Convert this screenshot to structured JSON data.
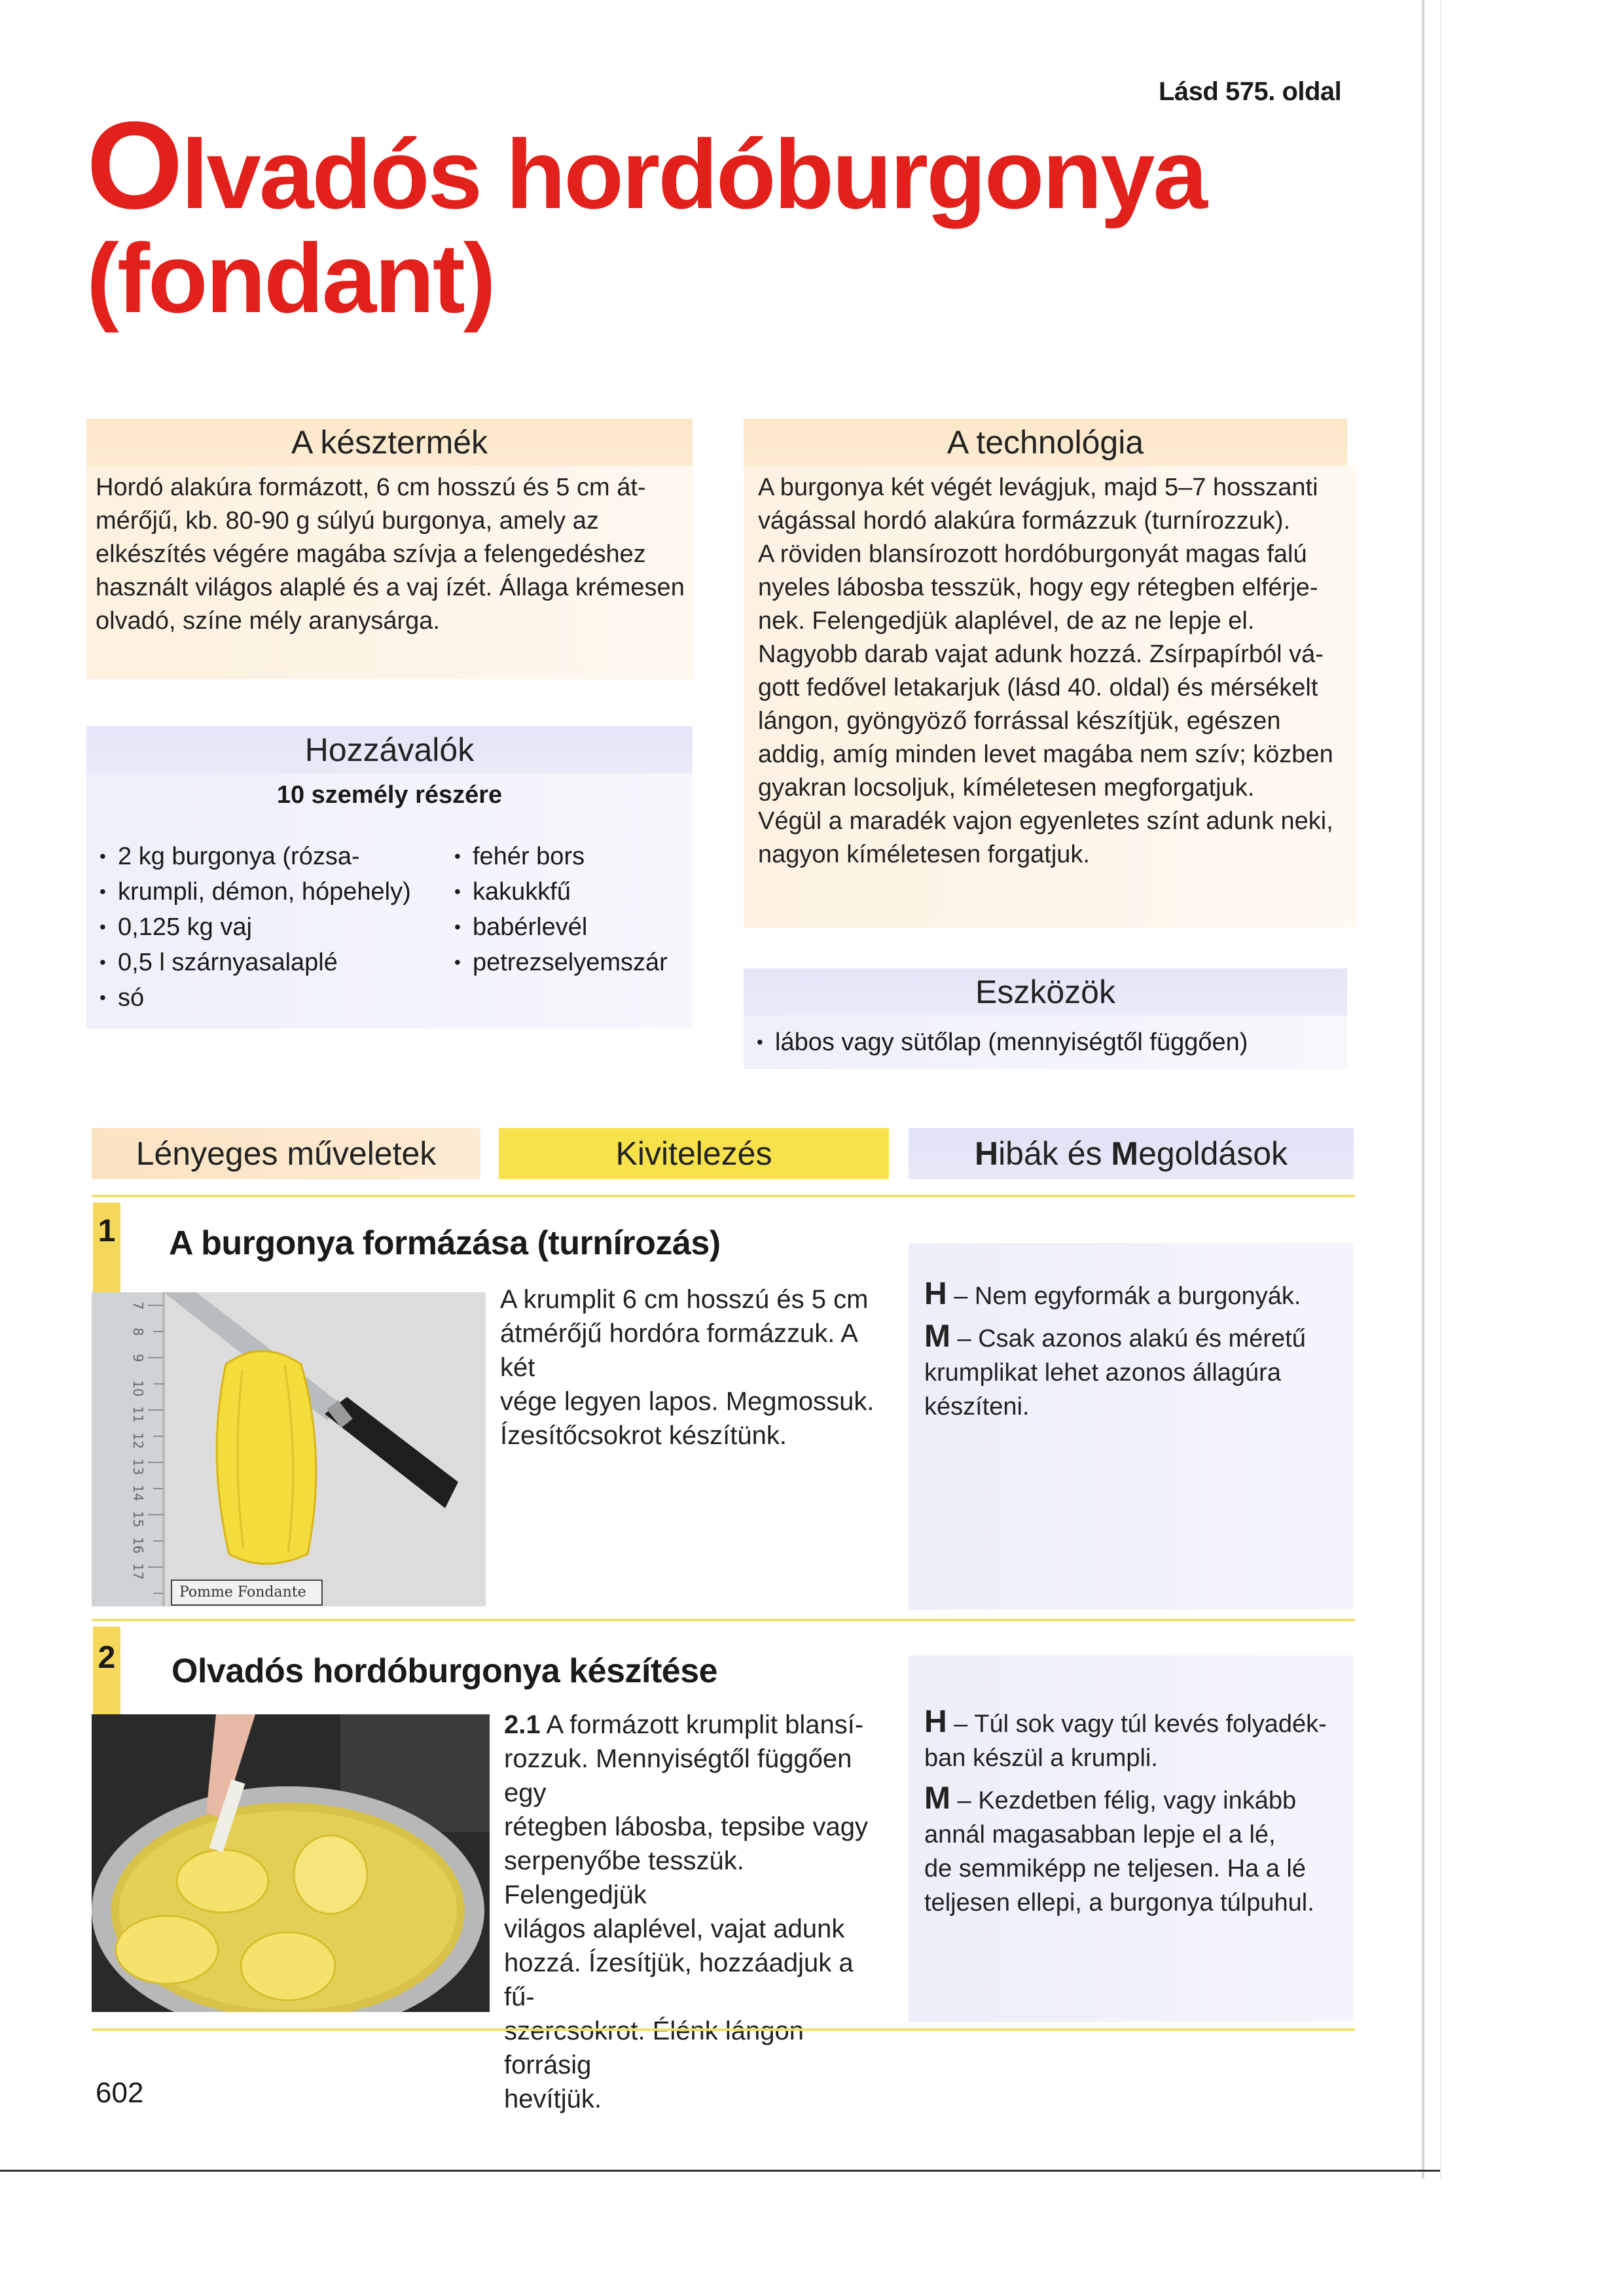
{
  "reference": "Lásd 575. oldal",
  "title": {
    "initial": "O",
    "line1_rest": "lvadós hordóburgonya",
    "line2": "(fondant)"
  },
  "kesztermek": {
    "heading": "A késztermék",
    "lines": [
      "Hordó alakúra formázott, 6 cm hosszú és 5 cm át-",
      "mérőjű, kb. 80-90 g súlyú burgonya, amely az",
      "elkészítés végére magába szívja a felengedéshez",
      "használt világos alaplé és a vaj ízét. Állaga krémesen",
      "olvadó, színe mély aranysárga."
    ]
  },
  "technologia": {
    "heading": "A technológia",
    "lines": [
      "A burgonya két végét levágjuk, majd 5–7 hosszanti",
      "vágással hordó alakúra formázzuk (turnírozzuk).",
      "A röviden blansírozott hordóburgonyát magas falú",
      "nyeles lábosba tesszük, hogy egy rétegben elférje-",
      "nek. Felengedjük alaplével, de az ne lepje el.",
      "Nagyobb darab vajat adunk hozzá. Zsírpapírból vá-",
      "gott fedővel letakarjuk (lásd 40. oldal) és mérsékelt",
      "lángon, gyöngyöző forrással készítjük, egészen",
      "addig, amíg minden levet magába nem szív; közben",
      "gyakran locsoljuk, kíméletesen megforgatjuk.",
      "Végül a maradék vajon egyenletes színt adunk neki,",
      "nagyon kíméletesen forgatjuk."
    ]
  },
  "hozzavalok": {
    "heading": "Hozzávalók",
    "subheading": "10 személy részére",
    "col1": [
      {
        "text": "2 kg burgonya (rózsa-",
        "cont": "krumpli, démon, hópehely)"
      },
      {
        "text": "0,125 kg vaj"
      },
      {
        "text": "0,5 l szárnyasalaplé"
      },
      {
        "text": "só"
      }
    ],
    "col2": [
      "fehér bors",
      "kakukkfű",
      "babérlevél",
      "petrezselyemszár"
    ]
  },
  "eszkozok": {
    "heading": "Eszközök",
    "items": [
      "lábos vagy sütőlap (mennyiségtől függően)"
    ]
  },
  "sections": {
    "lenyeges": "Lényeges műveletek",
    "kivitelezes": "Kivitelezés",
    "hibak_h": "H",
    "hibak_rest1": "ibák és ",
    "hibak_m": "M",
    "hibak_rest2": "egoldások"
  },
  "steps": [
    {
      "num": "1",
      "title": "A burgonya formázása (turnírozás)",
      "text_lines": [
        "A krumplit 6 cm hosszú és 5 cm",
        "átmérőjű hordóra formázzuk. A két",
        "vége legyen lapos. Megmossuk.",
        "Ízesítőcsokrot készítünk."
      ],
      "photo_caption": "Pomme Fondante",
      "h_letter": "H",
      "h_text": "– Nem egyformák a burgonyák.",
      "m_letter": "M",
      "m_lines": [
        "– Csak azonos alakú és méretű",
        "krumplikat lehet azonos állagúra",
        "készíteni."
      ]
    },
    {
      "num": "2",
      "title": "Olvadós hordóburgonya készítése",
      "sub_num": "2.1",
      "text_lines": [
        "A formázott krumplit blansí-",
        "rozzuk. Mennyiségtől függően egy",
        "rétegben lábosba, tepsibe vagy",
        "serpenyőbe tesszük. Felengedjük",
        "világos alaplével, vajat adunk",
        "hozzá. Ízesítjük, hozzáadjuk a fű-",
        "szercsokrot. Élénk lángon forrásig",
        "hevítjük."
      ],
      "h_letter": "H",
      "h_lines": [
        "– Túl sok vagy túl kevés folyadék-",
        "ban készül a krumpli."
      ],
      "m_letter": "M",
      "m_lines": [
        "– Kezdetben félig, vagy inkább",
        "annál magasabban lepje el a lé,",
        "de semmiképp ne teljesen. Ha a lé",
        "teljesen ellepi, a burgonya túlpuhul."
      ]
    }
  ],
  "ruler_numbers": [
    "7",
    "8",
    "9",
    "10",
    "11",
    "12",
    "13",
    "14",
    "15",
    "16",
    "17"
  ],
  "page_number": "602",
  "colors": {
    "title_red": "#e3211c",
    "yellow": "#f7e24b",
    "peach": "#fbe7c9",
    "lavender": "#e3e6f7"
  }
}
